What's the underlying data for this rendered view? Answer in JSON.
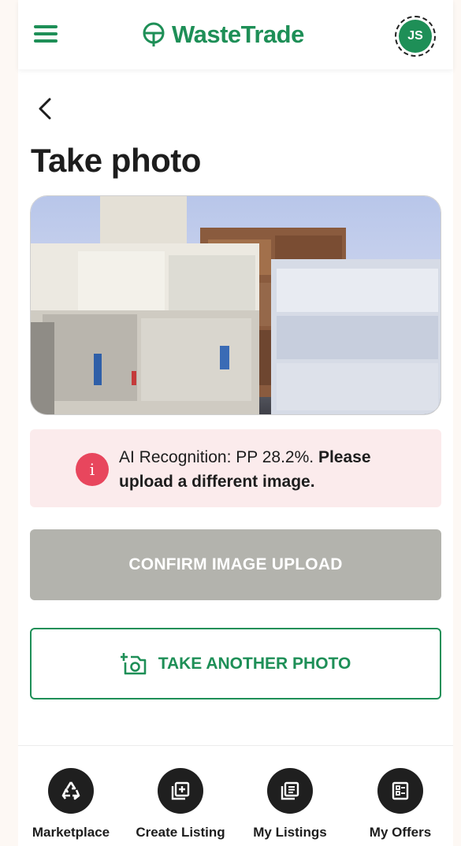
{
  "header": {
    "brand": "WasteTrade",
    "avatar_initials": "JS",
    "brand_color": "#1e8f57"
  },
  "page": {
    "title": "Take photo"
  },
  "alert": {
    "prefix": "AI Recognition: PP 28.2%.",
    "emphasis": "Please upload a different image.",
    "icon_glyph": "i",
    "icon_color": "#e8465d",
    "background": "#fbebec"
  },
  "buttons": {
    "confirm_label": "CONFIRM IMAGE UPLOAD",
    "another_label": "TAKE ANOTHER PHOTO"
  },
  "bottom_nav": {
    "items": [
      {
        "label": "Marketplace",
        "icon": "recycle-icon"
      },
      {
        "label": "Create Listing",
        "icon": "add-box-icon"
      },
      {
        "label": "My Listings",
        "icon": "listings-icon"
      },
      {
        "label": "My Offers",
        "icon": "offers-icon"
      }
    ]
  }
}
